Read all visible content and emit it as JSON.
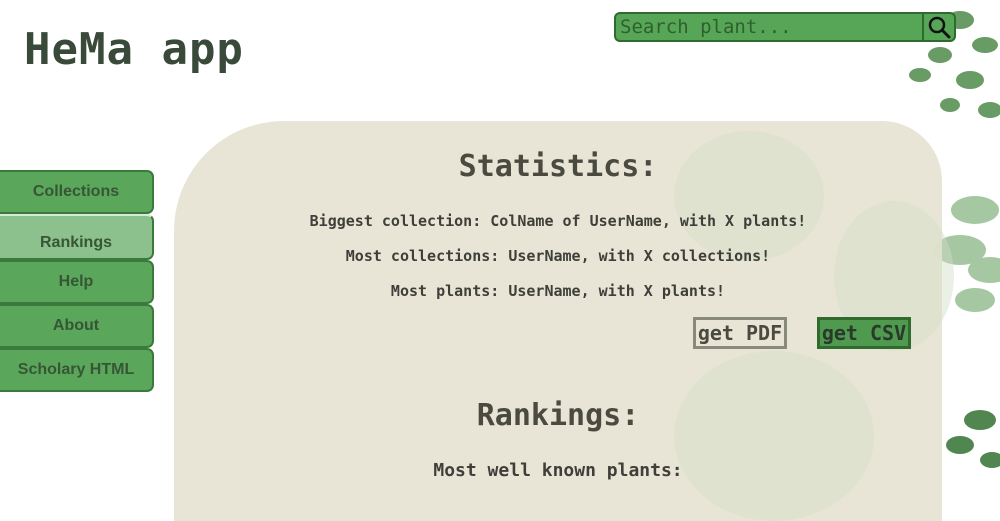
{
  "header": {
    "app_title": "HeMa app"
  },
  "search": {
    "placeholder": "Search plant...",
    "icon": "search-icon"
  },
  "sidebar": {
    "items": [
      {
        "label": "Collections"
      },
      {
        "label": "Rankings",
        "active": true
      },
      {
        "label": "Help"
      },
      {
        "label": "About"
      },
      {
        "label": "Scholary HTML"
      }
    ]
  },
  "statistics": {
    "title": "Statistics:",
    "lines": [
      "Biggest collection: ColName of UserName, with X plants!",
      "Most collections: UserName, with X collections!",
      "Most plants: UserName, with X plants!"
    ],
    "pdf_label": "get PDF",
    "csv_label": "get CSV"
  },
  "rankings": {
    "title": "Rankings:",
    "subtitle": "Most well known plants:"
  },
  "colors": {
    "accent_green": "#57a657",
    "dark_green": "#2f6b2f",
    "panel_bg": "#e8e4d4",
    "title_text": "#3a4a3a"
  }
}
